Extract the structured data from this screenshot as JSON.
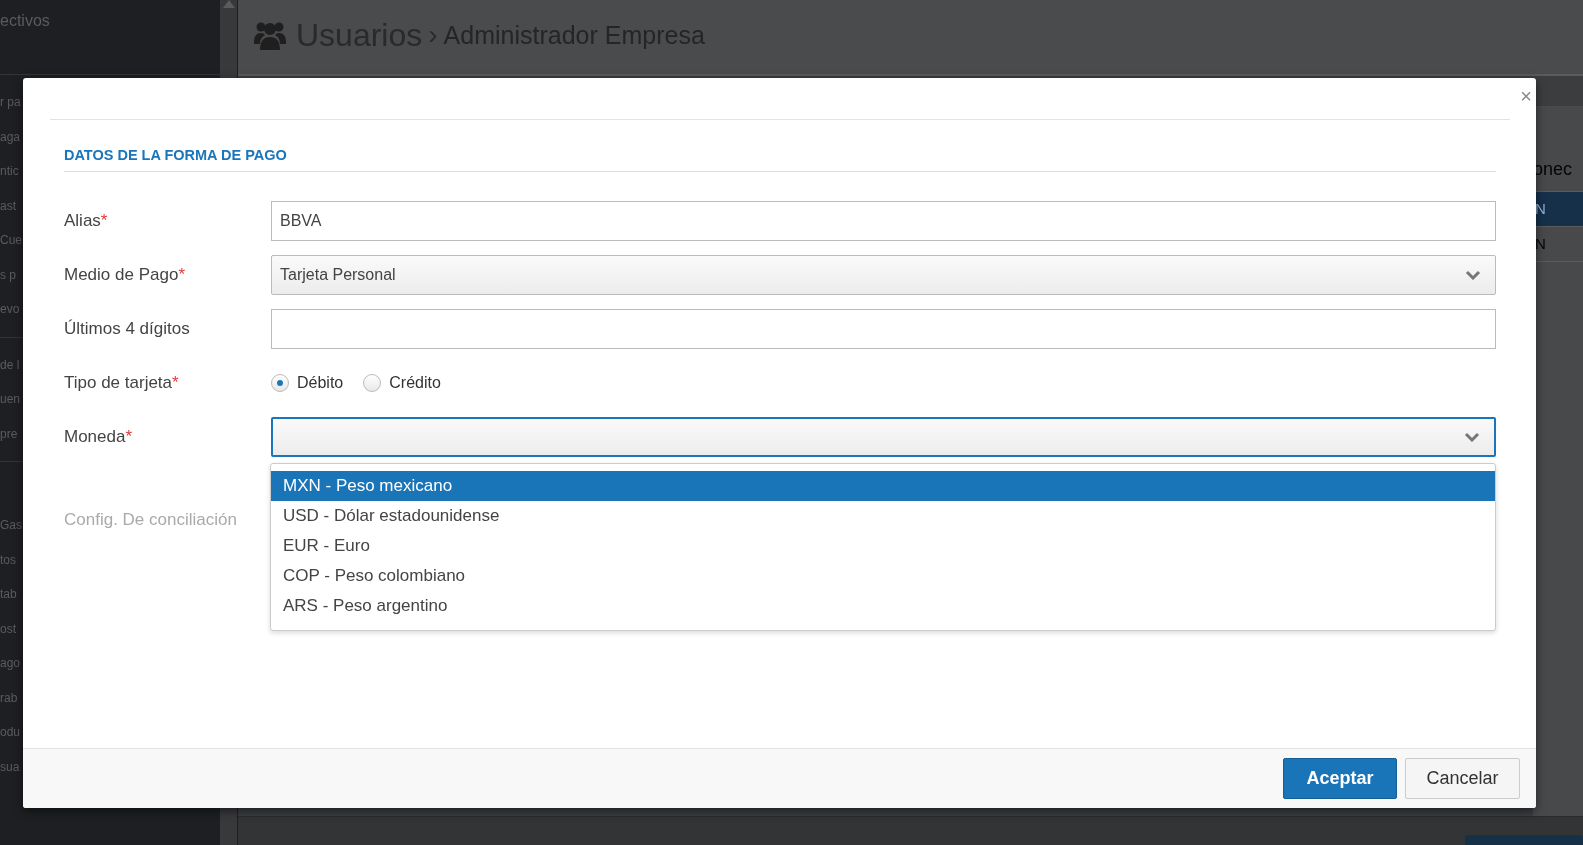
{
  "sidebar": {
    "groups": [
      {
        "items": [
          {
            "label": "ectivos"
          }
        ]
      },
      {
        "items": [
          {
            "label": "r pa"
          },
          {
            "label": "aga"
          },
          {
            "label": "ntic"
          },
          {
            "label": "ast"
          },
          {
            "label": "Cue"
          },
          {
            "label": "s p"
          },
          {
            "label": "evo"
          }
        ]
      },
      {
        "items": [
          {
            "label": "de l"
          },
          {
            "label": "uen"
          },
          {
            "label": "pre"
          }
        ]
      },
      {
        "items": [
          {
            "label": "Gas"
          },
          {
            "label": "tos"
          },
          {
            "label": "tab"
          },
          {
            "label": "ost"
          },
          {
            "label": "ago"
          },
          {
            "label": "rab"
          },
          {
            "label": "odu"
          },
          {
            "label": "sua"
          }
        ]
      }
    ]
  },
  "header": {
    "title": "Usuarios",
    "separator": "›",
    "subtitle": "Administrador Empresa"
  },
  "table": {
    "column_heading": "onec",
    "rows": [
      {
        "cell": "N",
        "selected": true
      },
      {
        "cell": "N",
        "selected": false
      }
    ]
  },
  "modal": {
    "close_label": "×",
    "section_title": "DATOS DE LA FORMA DE PAGO",
    "fields": [
      {
        "kind": "text",
        "label": "Alias",
        "required_mark": "*",
        "value": "BBVA",
        "focused": false
      },
      {
        "kind": "select",
        "label": "Medio de Pago",
        "required_mark": "*",
        "value": "Tarjeta Personal",
        "focused": false
      },
      {
        "kind": "text",
        "label": "Últimos 4 dígitos",
        "focused": false
      },
      {
        "kind": "radio",
        "label": "Tipo de tarjeta",
        "required_mark": "*",
        "options": [
          {
            "label": "Débito",
            "selected": true
          },
          {
            "label": "Crédito",
            "selected": false
          }
        ]
      },
      {
        "kind": "select",
        "label": "Moneda",
        "required_mark": "*",
        "focused": true,
        "options": [
          {
            "label": "MXN - Peso mexicano",
            "selected": true
          },
          {
            "label": "USD - Dólar estadounidense",
            "selected": false
          },
          {
            "label": "EUR - Euro",
            "selected": false
          },
          {
            "label": "COP - Peso colombiano",
            "selected": false
          },
          {
            "label": "ARS - Peso argentino",
            "selected": false
          }
        ]
      },
      {
        "kind": "disabled",
        "label": "Config. De conciliación"
      }
    ],
    "buttons": [
      {
        "label": "Aceptar",
        "primary": true
      },
      {
        "label": "Cancelar",
        "primary": false
      }
    ]
  }
}
